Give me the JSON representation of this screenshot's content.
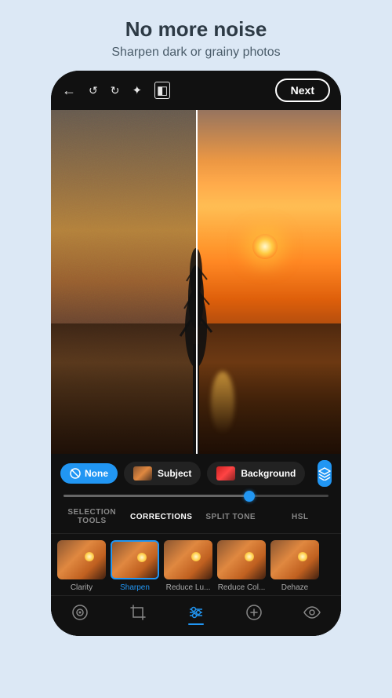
{
  "header": {
    "title": "No more noise",
    "subtitle": "Sharpen dark or grainy photos"
  },
  "toolbar": {
    "next_label": "Next",
    "icons": [
      "back",
      "undo",
      "redo",
      "magic-wand",
      "compare"
    ]
  },
  "mask_selector": {
    "none_label": "None",
    "subject_label": "Subject",
    "background_label": "Background"
  },
  "tabs": [
    {
      "label": "SELECTION TOOLS",
      "active": false
    },
    {
      "label": "CORRECTIONS",
      "active": true
    },
    {
      "label": "SPLIT TONE",
      "active": false
    },
    {
      "label": "HSL",
      "active": false
    }
  ],
  "corrections": [
    {
      "label": "Clarity",
      "active": false
    },
    {
      "label": "Sharpen",
      "active": true
    },
    {
      "label": "Reduce Lu...",
      "active": false
    },
    {
      "label": "Reduce Col...",
      "active": false
    },
    {
      "label": "Dehaze",
      "active": false
    }
  ],
  "bottom_nav": [
    {
      "icon": "camera-lens",
      "active": false
    },
    {
      "icon": "crop",
      "active": false
    },
    {
      "icon": "sliders",
      "active": true
    },
    {
      "icon": "healing",
      "active": false
    },
    {
      "icon": "eye",
      "active": false
    }
  ]
}
